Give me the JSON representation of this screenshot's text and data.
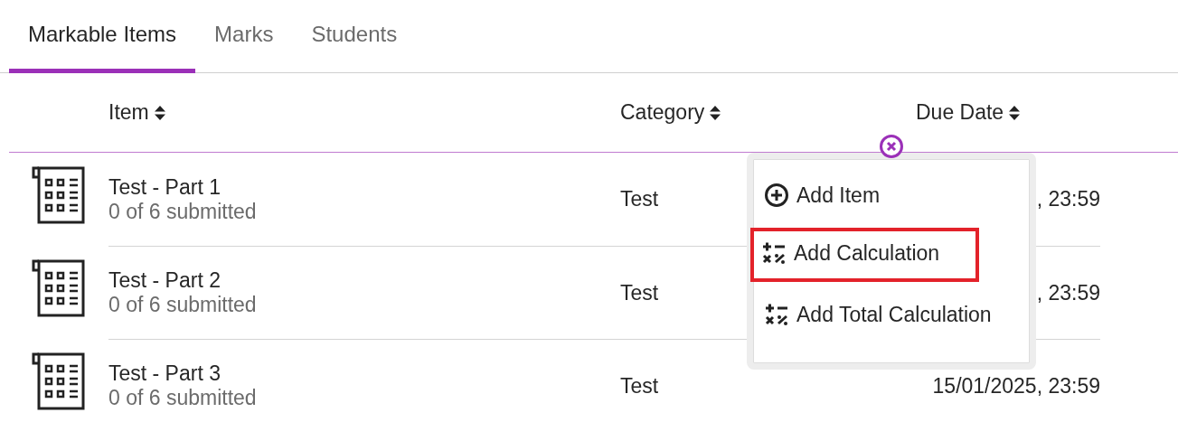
{
  "tabs": [
    {
      "label": "Markable Items",
      "selected": true
    },
    {
      "label": "Marks",
      "selected": false
    },
    {
      "label": "Students",
      "selected": false
    }
  ],
  "table": {
    "columns": [
      "Item",
      "Category",
      "Due Date"
    ],
    "rows": [
      {
        "item": "Test - Part 1",
        "submitted": "0 of 6 submitted",
        "category": "Test",
        "due_date": ", 23:59"
      },
      {
        "item": "Test - Part 2",
        "submitted": "0 of 6 submitted",
        "category": "Test",
        "due_date": ", 23:59"
      },
      {
        "item": "Test - Part 3",
        "submitted": "0 of 6 submitted",
        "category": "Test",
        "due_date": "15/01/2025, 23:59"
      }
    ]
  },
  "add_menu": {
    "items": [
      {
        "kind": "item",
        "label": "Add Item",
        "highlighted": false
      },
      {
        "kind": "calculation",
        "label": "Add Calculation",
        "highlighted": true
      },
      {
        "kind": "calculation",
        "label": "Add Total Calculation",
        "highlighted": false
      }
    ]
  }
}
